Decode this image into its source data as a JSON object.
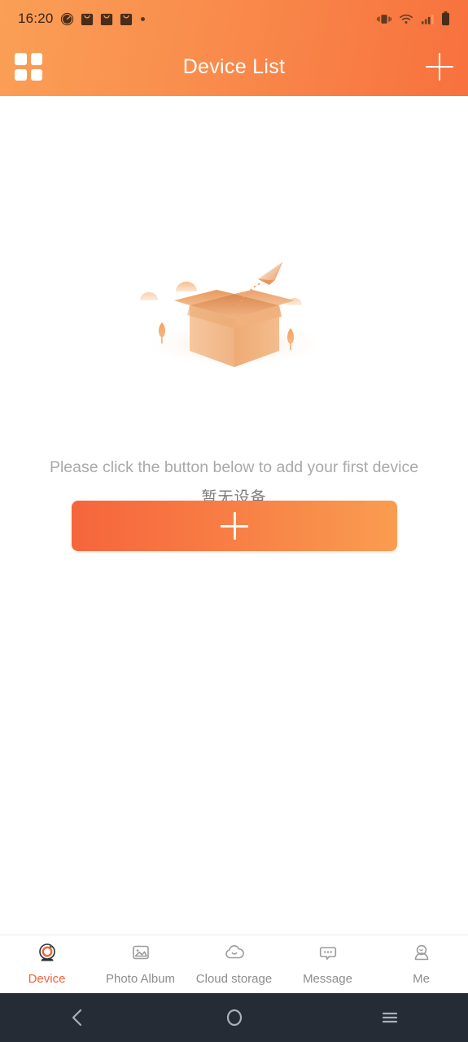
{
  "statusbar": {
    "time": "16:20",
    "left_icons": [
      "speedometer-icon",
      "shopping-bag-icon",
      "shopping-bag-icon",
      "shopping-bag-icon",
      "dot-icon"
    ],
    "right_icons": [
      "vibrate-icon",
      "wifi-icon",
      "signal-icon",
      "battery-icon"
    ]
  },
  "header": {
    "title": "Device List",
    "menu_icon": "grid-icon",
    "add_icon": "plus-icon",
    "gradient_start": "#fa9f56",
    "gradient_end": "#f7713e"
  },
  "main": {
    "illustration": "empty-box-illustration",
    "empty_text": "暂无设备",
    "hint_text": "Please click the button below to add your first device",
    "add_button": {
      "icon": "plus-icon",
      "label": "",
      "gradient_start": "#f6653c",
      "gradient_end": "#f99d50"
    }
  },
  "tabbar": {
    "active_color": "#f5603a",
    "inactive_color": "#8d8d8d",
    "items": [
      {
        "label": "Device",
        "icon": "camera-icon",
        "active": true
      },
      {
        "label": "Photo Album",
        "icon": "image-icon",
        "active": false
      },
      {
        "label": "Cloud storage",
        "icon": "cloud-icon",
        "active": false
      },
      {
        "label": "Message",
        "icon": "chat-bubble-icon",
        "active": false
      },
      {
        "label": "Me",
        "icon": "person-icon",
        "active": false
      }
    ]
  },
  "navbar": {
    "background": "#262c36",
    "items": [
      {
        "name": "back-icon"
      },
      {
        "name": "home-icon"
      },
      {
        "name": "recents-icon"
      }
    ]
  }
}
